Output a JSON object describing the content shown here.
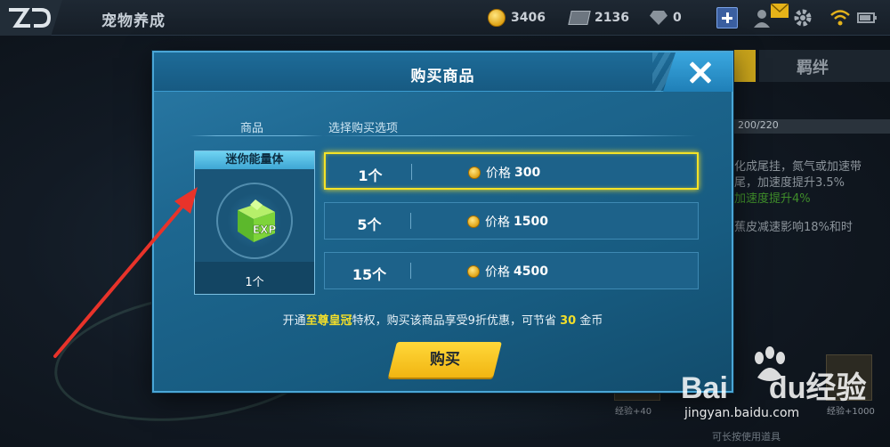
{
  "topbar": {
    "title": "宠物养成",
    "coins": "3406",
    "tickets": "2136",
    "gems": "0"
  },
  "dialog": {
    "title": "购买商品",
    "column_item": "商品",
    "column_options": "选择购买选项",
    "item": {
      "name": "迷你能量体",
      "icon_text": "EXP",
      "quantity": "1个"
    },
    "options": [
      {
        "count": "1个",
        "price_label": "价格",
        "price": "300",
        "selected": true
      },
      {
        "count": "5个",
        "price_label": "价格",
        "price": "1500",
        "selected": false
      },
      {
        "count": "15个",
        "price_label": "价格",
        "price": "4500",
        "selected": false
      }
    ],
    "promo": {
      "part1": "开通",
      "highlight1": "至尊皇冠",
      "part2": "特权，购买该商品享受9折优惠，可节省",
      "highlight2": "30",
      "part3": "金币"
    },
    "buy_label": "购买"
  },
  "right_panel": {
    "tab": "羁绊",
    "progress": "200/220",
    "lines": [
      "化成尾挂，氮气或加速带",
      "尾，加速度提升3.5%",
      "加速度提升4%",
      "蕉皮减速影响18%和时"
    ],
    "slot_labels": [
      "经验+40",
      "经验+1000"
    ],
    "hint": "可长按使用道具"
  },
  "watermark": {
    "brand_a": "Bai",
    "brand_b": "du",
    "brand_c": "经验",
    "site": "jingyan.baidu.com"
  },
  "colors": {
    "dialog_bg": "#1e6891",
    "selected_border": "#f4e227",
    "buy_button": "#f7c623",
    "highlight_text": "#f2de2a",
    "annotation_arrow": "#e8332a"
  }
}
